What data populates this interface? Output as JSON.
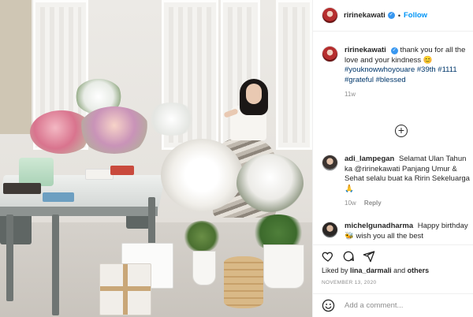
{
  "post": {
    "author": "ririnekawati",
    "follow_label": "Follow",
    "separator": "•"
  },
  "caption": {
    "user": "ririnekawati",
    "text": "thank you for all the love and your kindness 😊",
    "hashtags": "#youknowwhoyouare #39th #1111 #grateful #blessed",
    "time": "11w"
  },
  "comments": [
    {
      "user": "adi_lampegan",
      "text": "Selamat Ulan Tahun ka @ririnekawati Panjang Umur & Sehat selalu buat ka Ririn Sekeluarga🙏",
      "time": "10w",
      "reply_label": "Reply"
    },
    {
      "user": "michelgunadharma",
      "text": "Happy birthday🐝 wish you all the best",
      "time": "",
      "reply_label": ""
    }
  ],
  "likes": {
    "prefix": "Liked by",
    "user": "lina_darmali",
    "conjunction": "and",
    "others": "others"
  },
  "date": "NOVEMBER 13, 2020",
  "add_comment": {
    "placeholder": "Add a comment..."
  },
  "icons": {
    "verified": "verified-badge-icon",
    "plus": "plus-circle-icon",
    "like": "heart-icon",
    "comment": "comment-icon",
    "share": "share-icon",
    "emoji": "emoji-icon"
  },
  "colors": {
    "link": "#0095f6",
    "verified": "#3897f0",
    "hashtag": "#00376b",
    "muted": "#8e8e8e"
  }
}
